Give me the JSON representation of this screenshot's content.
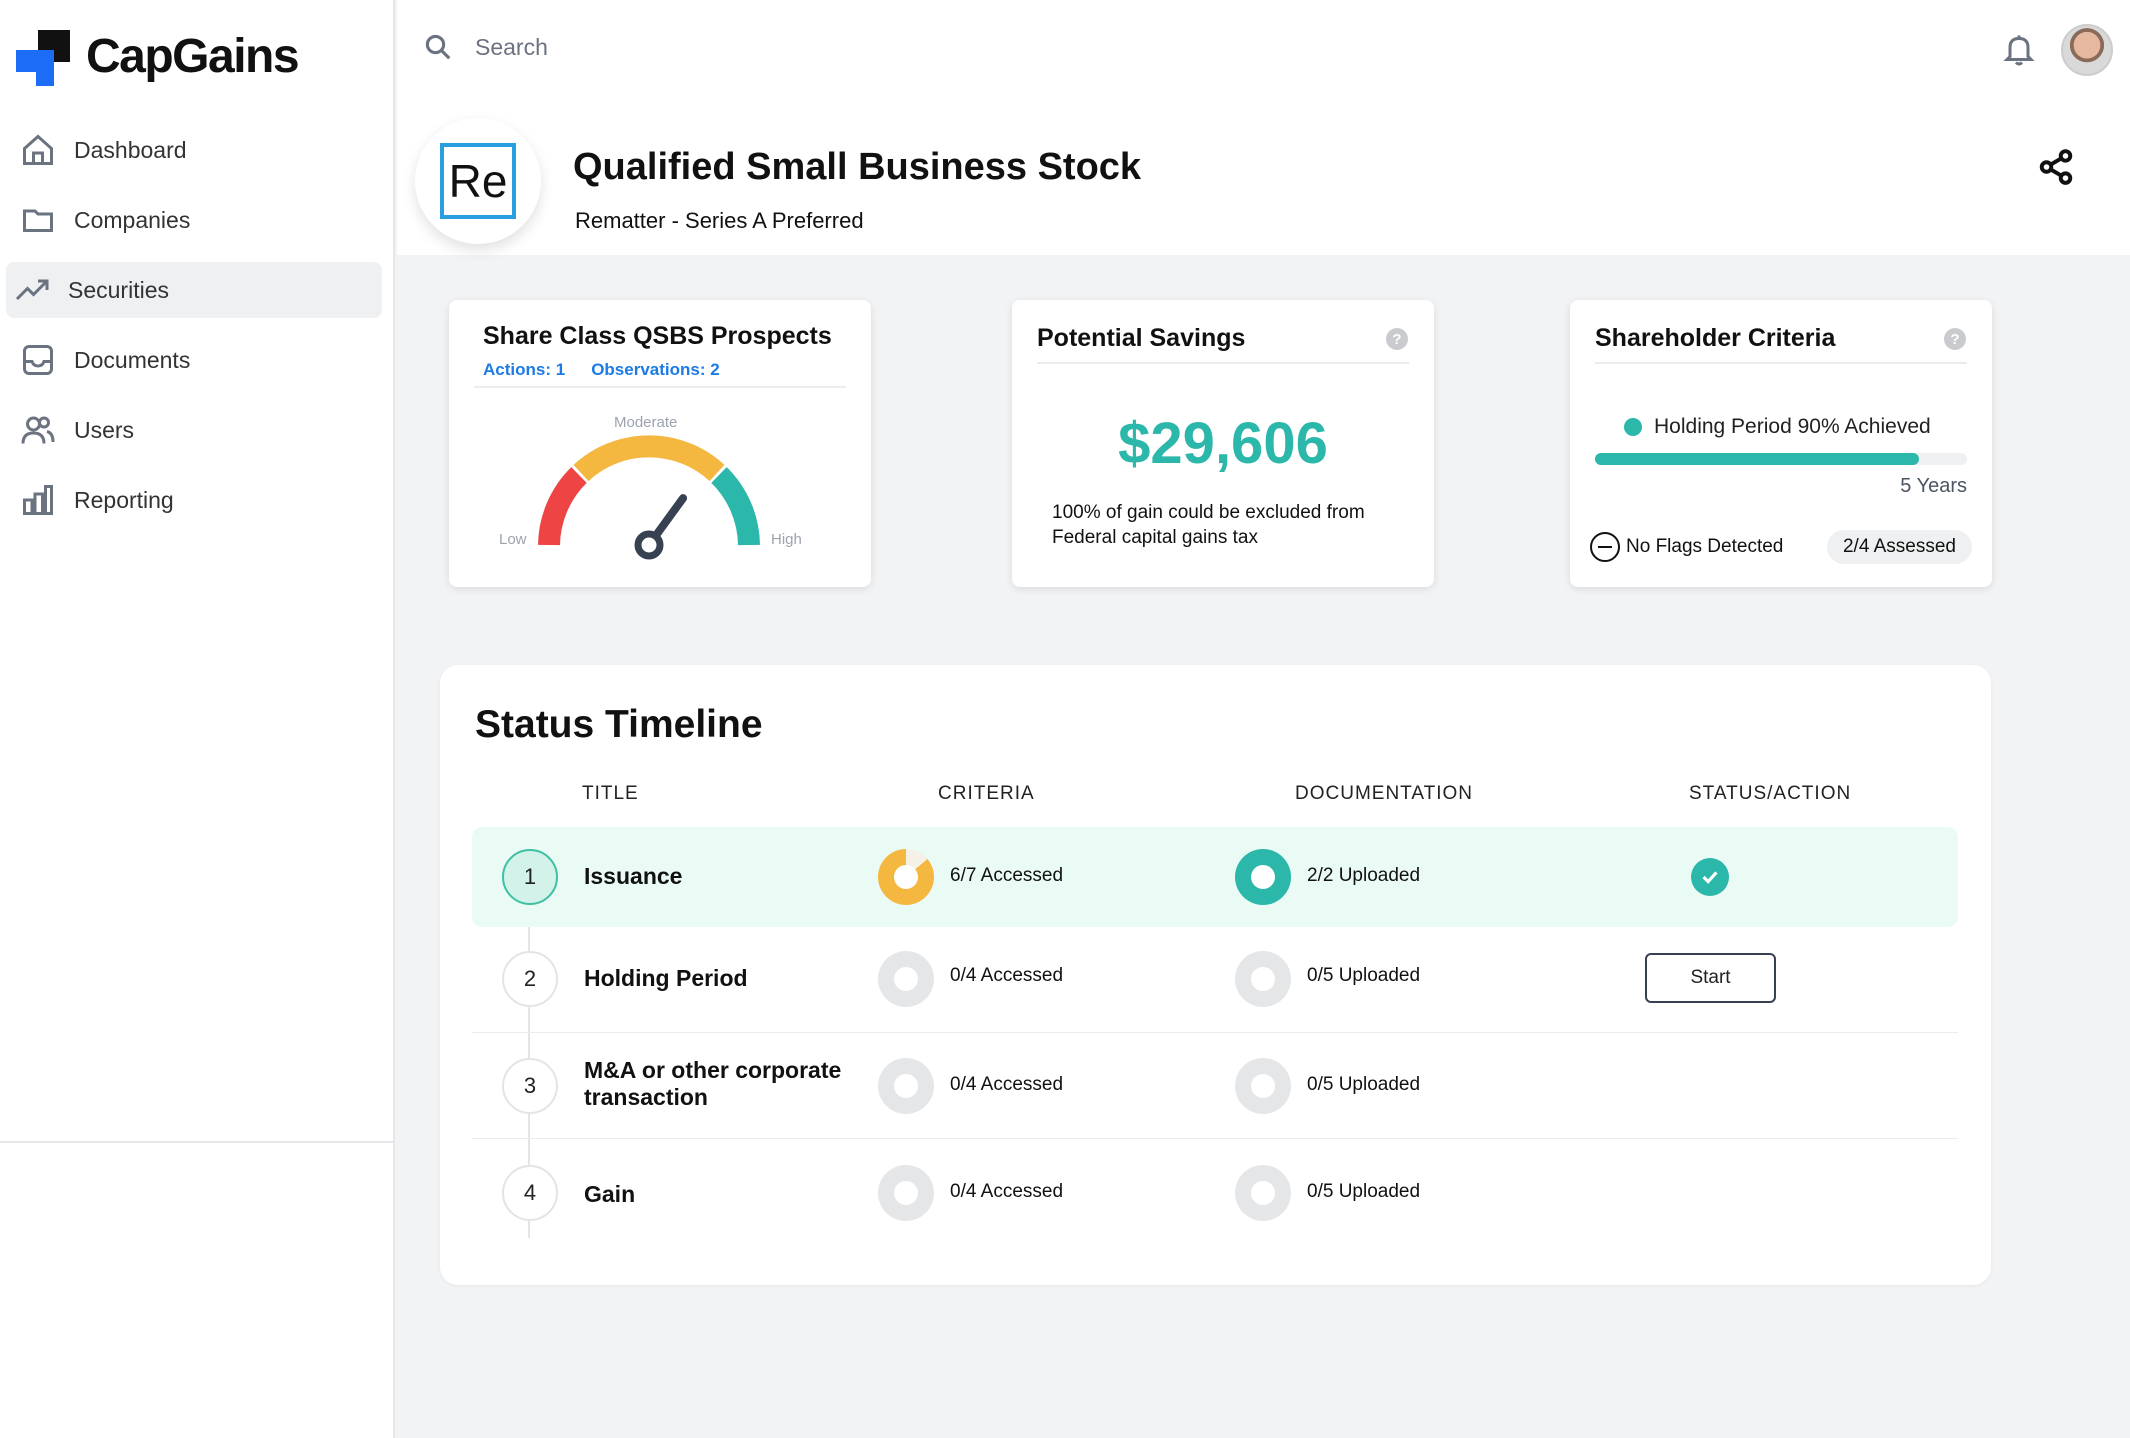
{
  "brand": {
    "name": "CapGains"
  },
  "sidebar": {
    "items": [
      {
        "label": "Dashboard",
        "icon": "home-icon"
      },
      {
        "label": "Companies",
        "icon": "folder-icon"
      },
      {
        "label": "Securities",
        "icon": "trending-up-icon",
        "active": true
      },
      {
        "label": "Documents",
        "icon": "inbox-icon"
      },
      {
        "label": "Users",
        "icon": "users-icon"
      },
      {
        "label": "Reporting",
        "icon": "bar-chart-icon"
      }
    ]
  },
  "header": {
    "search_placeholder": "Search"
  },
  "security": {
    "logo_text": "Re",
    "title": "Qualified Small Business Stock",
    "subtitle": "Rematter - Series A Preferred"
  },
  "cards": {
    "prospects": {
      "title": "Share Class QSBS Prospects",
      "actions": "Actions: 1",
      "observations": "Observations: 2",
      "gauge": {
        "low": "Low",
        "moderate": "Moderate",
        "high": "High"
      },
      "gauge_level_fraction": 0.7
    },
    "savings": {
      "title": "Potential Savings",
      "amount": "$29,606",
      "note": "100% of gain could be excluded from Federal capital gains tax"
    },
    "shareholder": {
      "title": "Shareholder Criteria",
      "holding_label": "Holding Period 90% Achieved",
      "holding_progress": 0.87,
      "years": "5 Years",
      "flags": "No Flags Detected",
      "assessed": "2/4 Assessed"
    }
  },
  "timeline": {
    "title": "Status Timeline",
    "columns": {
      "title": "TITLE",
      "criteria": "CRITERIA",
      "documentation": "DOCUMENTATION",
      "status": "STATUS/ACTION"
    },
    "rows": [
      {
        "num": "1",
        "title": "Issuance",
        "criteria": "6/7 Accessed",
        "documentation": "2/2 Uploaded"
      },
      {
        "num": "2",
        "title": "Holding Period",
        "criteria": "0/4 Accessed",
        "documentation": "0/5 Uploaded",
        "action": "Start"
      },
      {
        "num": "3",
        "title": "M&A or other corporate transaction",
        "criteria": "0/4 Accessed",
        "documentation": "0/5 Uploaded"
      },
      {
        "num": "4",
        "title": "Gain",
        "criteria": "0/4 Accessed",
        "documentation": "0/5 Uploaded"
      }
    ]
  },
  "colors": {
    "accent": "#2bb7a9",
    "brand_blue": "#1d6cf5",
    "link_blue": "#1d7be5",
    "warning": "#f4b740",
    "danger": "#ef4444"
  }
}
